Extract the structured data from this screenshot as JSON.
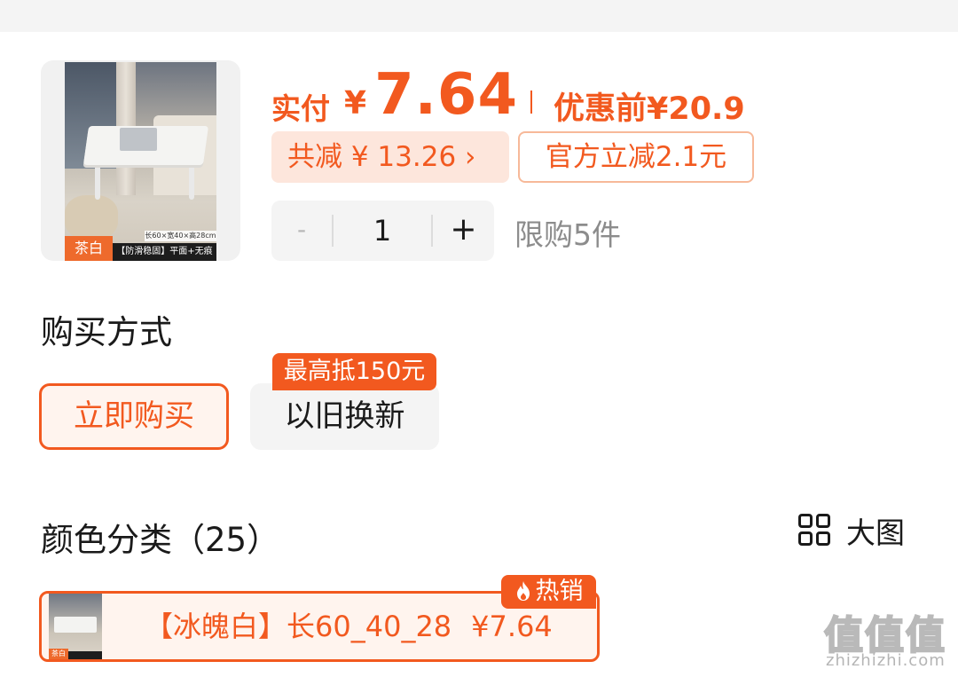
{
  "product": {
    "thumb_color_label": "茶白",
    "thumb_banner": "【防滑稳固】平面+无痕",
    "thumb_dimensions": "长60×宽40×高28cm"
  },
  "price": {
    "pay_label": "实付",
    "currency": "¥",
    "pay_amount": "7.64",
    "pre_discount": "优惠前¥20.9",
    "total_discount": "共减 ¥ 13.26 ›",
    "official_discount": "官方立减2.1元"
  },
  "quantity": {
    "minus": "-",
    "value": "1",
    "plus": "+",
    "limit": "限购5件"
  },
  "purchase_method": {
    "title": "购买方式",
    "buy_now": "立即购买",
    "trade_in": "以旧换新",
    "trade_in_badge": "最高抵150元"
  },
  "color_category": {
    "title": "颜色分类（25）",
    "big_view_label": "大图",
    "hot_badge": "热销",
    "selected_variant": {
      "name": "【冰魄白】长60_40_28",
      "price": "¥7.64",
      "thumb_tag": "茶白"
    }
  },
  "watermark": {
    "glyphs": "值值值",
    "url": "zhizhizhi.com"
  },
  "colors": {
    "accent": "#f2591f",
    "accent_light": "#fde6dc",
    "neutral_bg": "#f4f4f4"
  }
}
